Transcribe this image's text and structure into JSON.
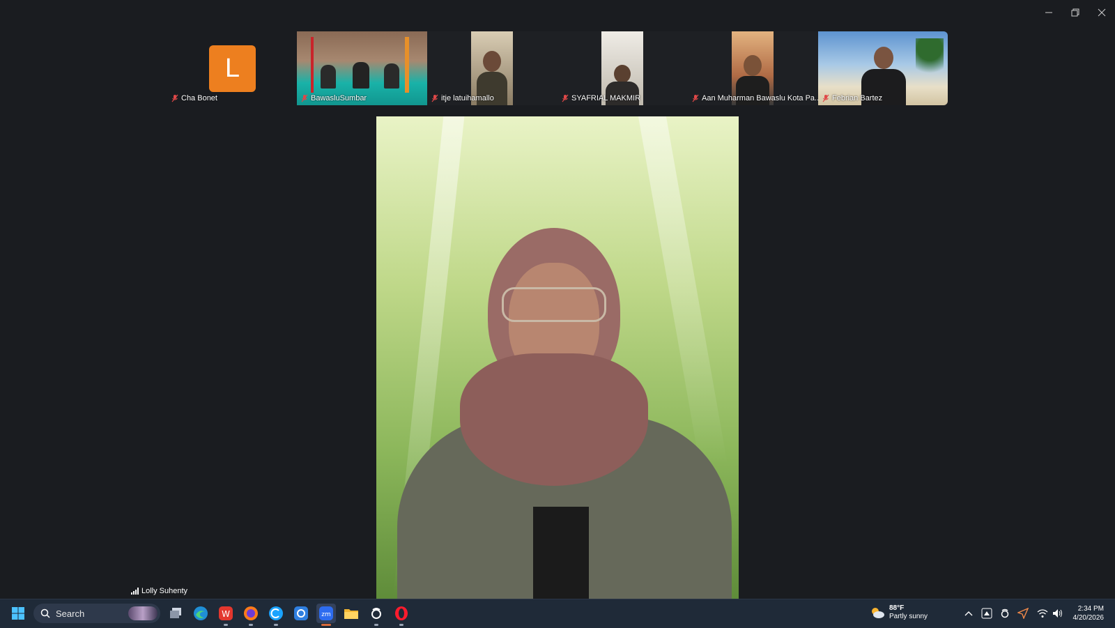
{
  "meeting": {
    "participants": [
      {
        "name": "Cha Bonet",
        "avatar_letter": "L",
        "muted": true
      },
      {
        "name": "BawasluSumbar",
        "muted": true
      },
      {
        "name": "itje latuihamallo",
        "muted": true
      },
      {
        "name": "SYAFRIAL MAKMIR",
        "muted": true
      },
      {
        "name": "Aan Muharman Bawaslu Kota Pa...",
        "muted": true
      },
      {
        "name": "Febrian Bartez",
        "muted": true
      }
    ],
    "active_speaker": {
      "name": "Lolly Suhenty"
    }
  },
  "taskbar": {
    "search_label": "Search",
    "weather": {
      "temp": "88°F",
      "condition": "Partly sunny"
    },
    "clock": {
      "time": "2:34 PM",
      "date": "4/20/2026"
    }
  },
  "colors": {
    "avatar": "#ed7f1f",
    "taskbar": "#1f2a38",
    "background": "#1a1c20"
  }
}
